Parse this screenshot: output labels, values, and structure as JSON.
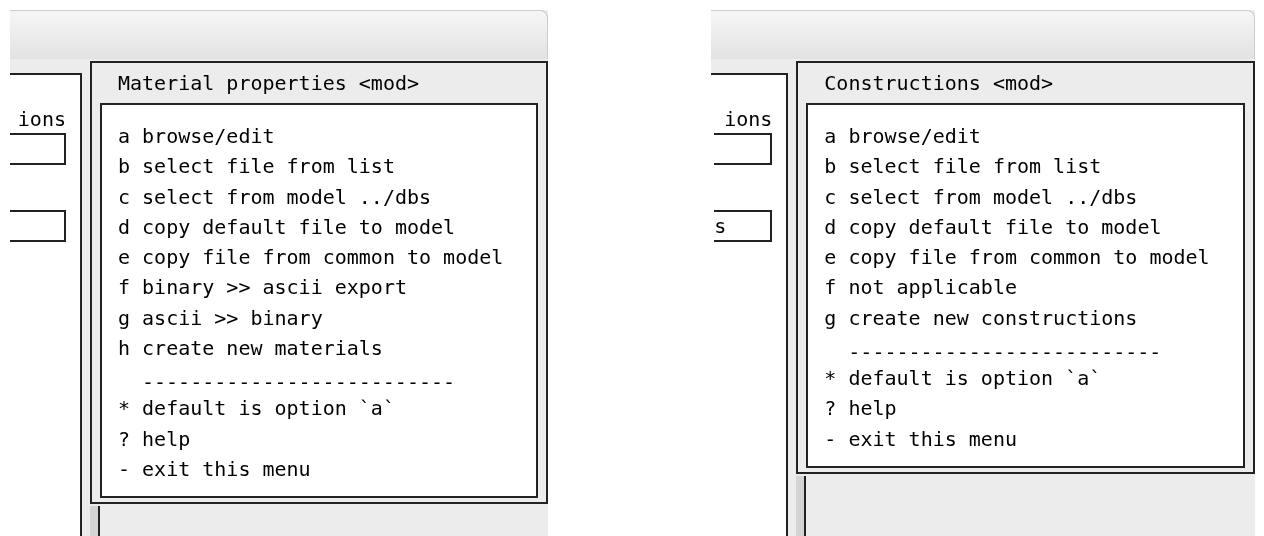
{
  "windows": [
    {
      "side_pane": {
        "label": "ions",
        "fields": [
          {
            "kind": "input"
          },
          {
            "kind": "input"
          }
        ]
      },
      "menu": {
        "title": "Material properties <mod>",
        "items": [
          {
            "kind": "option",
            "text": "a browse/edit"
          },
          {
            "kind": "option",
            "text": "b select file from list"
          },
          {
            "kind": "option",
            "text": "c select from model ../dbs"
          },
          {
            "kind": "option",
            "text": "d copy default file to model"
          },
          {
            "kind": "option",
            "text": "e copy file from common to model"
          },
          {
            "kind": "option",
            "text": "f binary >> ascii export"
          },
          {
            "kind": "option",
            "text": "g ascii >> binary"
          },
          {
            "kind": "option",
            "text": "h create new materials"
          },
          {
            "kind": "separator",
            "text": "--------------------------"
          },
          {
            "kind": "option",
            "text": "* default is option `a`"
          },
          {
            "kind": "option",
            "text": "? help"
          },
          {
            "kind": "option",
            "text": "- exit this menu"
          }
        ]
      }
    },
    {
      "side_pane": {
        "label": "ions",
        "fields": [
          {
            "kind": "input"
          },
          {
            "kind": "input",
            "value": "s"
          }
        ]
      },
      "menu": {
        "title": "Constructions <mod>",
        "items": [
          {
            "kind": "option",
            "text": "a browse/edit"
          },
          {
            "kind": "option",
            "text": "b select file from list"
          },
          {
            "kind": "option",
            "text": "c select from model ../dbs"
          },
          {
            "kind": "option",
            "text": "d copy default file to model"
          },
          {
            "kind": "option",
            "text": "e copy file from common to model"
          },
          {
            "kind": "option",
            "text": "f not applicable"
          },
          {
            "kind": "option",
            "text": "g create new constructions"
          },
          {
            "kind": "separator",
            "text": "--------------------------"
          },
          {
            "kind": "option",
            "text": "* default is option `a`"
          },
          {
            "kind": "option",
            "text": "? help"
          },
          {
            "kind": "option",
            "text": "- exit this menu"
          }
        ]
      }
    }
  ]
}
